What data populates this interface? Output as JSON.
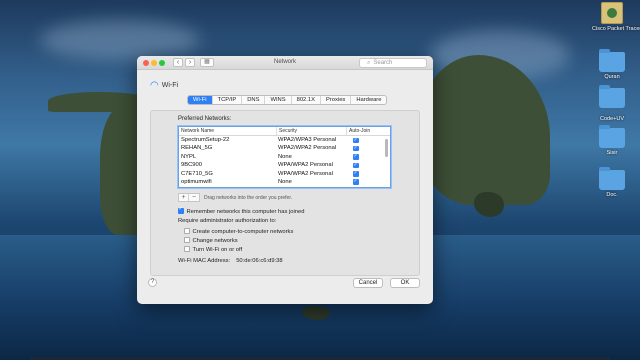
{
  "desktop": {
    "icons": [
      {
        "label": "Cisco Packet Tracer",
        "type": "app"
      },
      {
        "label": "Quran",
        "type": "folder"
      },
      {
        "label": "",
        "type": "folder"
      },
      {
        "label": "Code+UV",
        "type": "folder"
      },
      {
        "label": "Sisir",
        "type": "folder"
      },
      {
        "label": "Doc.",
        "type": "folder"
      }
    ]
  },
  "window": {
    "title": "Network",
    "search_placeholder": "Search",
    "nav_back": "‹",
    "nav_forward": "›",
    "grid_icon": "grid-icon",
    "interface_name": "Wi-Fi",
    "wifi_glyph": "wifi-icon",
    "tabs": [
      "Wi-Fi",
      "TCP/IP",
      "DNS",
      "WINS",
      "802.1X",
      "Proxies",
      "Hardware"
    ],
    "active_tab": "Wi-Fi",
    "preferred_networks_label": "Preferred Networks:",
    "table": {
      "columns": [
        "Network Name",
        "Security",
        "Auto-Join"
      ],
      "rows": [
        {
          "name": "SpectrumSetup-22",
          "security": "WPA2/WPA3 Personal",
          "auto_join": true
        },
        {
          "name": "REHAN_5G",
          "security": "WPA2/WPA2 Personal",
          "auto_join": true
        },
        {
          "name": "NYPL",
          "security": "None",
          "auto_join": true
        },
        {
          "name": "9BC900",
          "security": "WPA/WPA2 Personal",
          "auto_join": true
        },
        {
          "name": "C7E710_5G",
          "security": "WPA/WPA2 Personal",
          "auto_join": true
        },
        {
          "name": "optimumwifi",
          "security": "None",
          "auto_join": true
        }
      ]
    },
    "add_label": "+",
    "remove_label": "−",
    "drag_note": "Drag networks into the order you prefer.",
    "remember_label": "Remember networks this computer has joined",
    "remember_checked": true,
    "admin_label": "Require administrator authorization to:",
    "admin_options": [
      {
        "label": "Create computer-to-computer networks",
        "checked": false
      },
      {
        "label": "Change networks",
        "checked": false
      },
      {
        "label": "Turn Wi-Fi on or off",
        "checked": false
      }
    ],
    "mac_label": "Wi-Fi MAC Address:",
    "mac_value": "50:de:06:c6:d9:38",
    "help_label": "?",
    "cancel_label": "Cancel",
    "ok_label": "OK"
  }
}
